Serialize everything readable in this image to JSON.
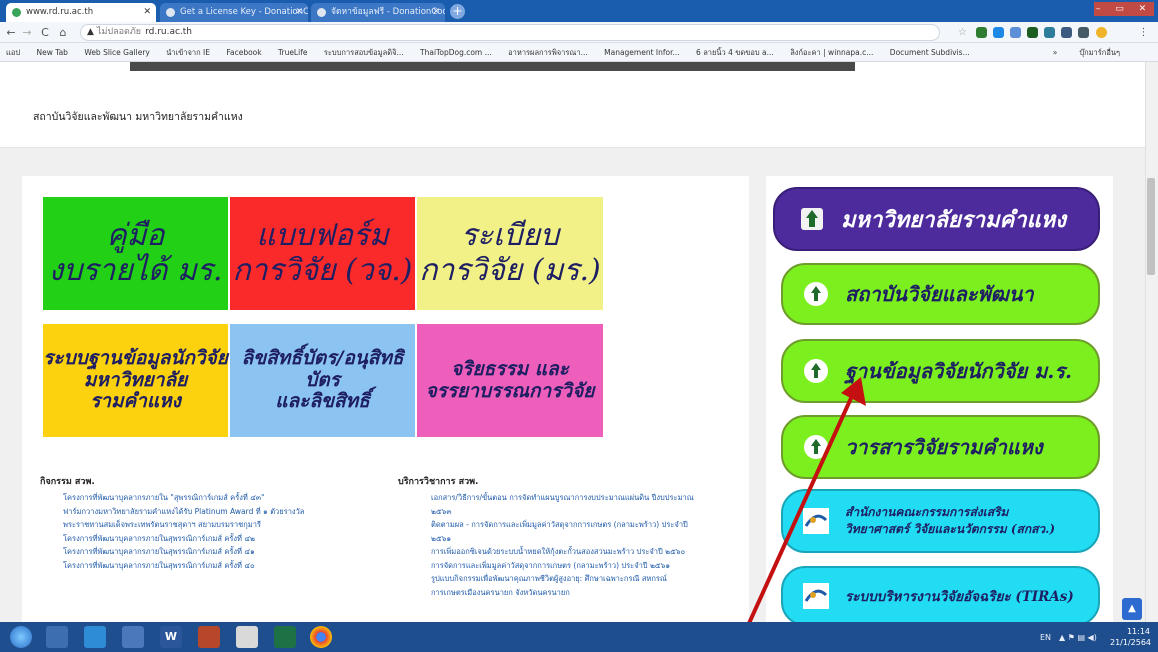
{
  "browser": {
    "tabs": [
      {
        "title": "www.rd.ru.ac.th",
        "active": true
      },
      {
        "title": "Get a License Key - DonationCoder",
        "active": false
      },
      {
        "title": "จัดหาข้อมูลฟรี - DonationCoder",
        "active": false
      }
    ],
    "new_tab_label": "+",
    "url_prefix": "ไม่ปลอดภัย",
    "url": "rd.ru.ac.th",
    "window_controls": "– ▭ ✕",
    "nav": {
      "back": "←",
      "forward": "→",
      "reload": "C",
      "home": "⌂",
      "warning": "▲"
    },
    "bookmarks": [
      "แอป",
      "New Tab",
      "Web Slice Gallery",
      "นำเข้าจาก IE",
      "Facebook",
      "TrueLife",
      "ระบบการสอบข้อมูลดิจิ...",
      "ThaiTopDog.com ...",
      "อาหารผลการพิจารณา...",
      "Management Infor...",
      "6 ลายนิ้ว 4 ขดขอบ a...",
      "ลิงก์อะคา | winnapa.c...",
      "Document Subdivis..."
    ],
    "bookmarks_other": "บุ๊กมาร์กอื่นๆ",
    "bookmarks_more": "»"
  },
  "site": {
    "title": "สถาบันวิจัยและพัฒนา มหาวิทยาลัยรามคำแหง"
  },
  "boxes": [
    {
      "line1": "คู่มือ",
      "line2": "งบรายได้ มร.",
      "color": "#22d015"
    },
    {
      "line1": "แบบฟอร์ม",
      "line2": "การวิจัย (วจ.)",
      "color": "#fb2a2a"
    },
    {
      "line1": "ระเบียบ",
      "line2": "การวิจัย (มร.)",
      "color": "#f1f188"
    },
    {
      "line1": "ระบบฐานข้อมูลนักวิจัย",
      "line2": "มหาวิทยาลัยรามคำแหง",
      "color": "#fcd10e"
    },
    {
      "line1": "ลิขสิทธิ์บัตร/อนุสิทธิบัตร",
      "line2": "และลิขสิทธิ์",
      "color": "#8cc4f1"
    },
    {
      "line1": "จริยธรรม และ",
      "line2": "จรรยาบรรณการวิจัย",
      "color": "#ed5fba"
    }
  ],
  "activities": {
    "heading": "กิจกรรม สวพ.",
    "items": [
      "โครงการที่พัฒนาบุคลากรภายใน \"สุพรรณิการ์เกมส์ ครั้งที่ ๔๓\"",
      "ฟาร์มกวางมหาวิทยาลัยรามคำแหงได้รับ Platinum Award ที่ ๑ ตัวยรางวัล",
      "พระราชทานสมเด็จพระเทพรัตนราชสุดาฯ สยามบรมราชกุมารี",
      "โครงการที่พัฒนาบุคลากรภายในสุพรรณิการ์เกมส์ ครั้งที่ ๔๒",
      "โครงการที่พัฒนาบุคลากรภายในสุพรรณิการ์เกมส์ ครั้งที่ ๔๑",
      "โครงการที่พัฒนาบุคลากรภายในสุพรรณิการ์เกมส์ ครั้งที่ ๔๐"
    ]
  },
  "services": {
    "heading": "บริการวิชาการ สวพ.",
    "items": [
      "เอกสาร/วิธีการ/ขั้นตอน การจัดทำแผนบูรณาการงบประมาณแผ่นดิน ปีงบประมาณ",
      "๒๕๖๓",
      "ติดตามผล - การจัดการและเพิ่มมูลค่าวัสดุจากการเกษตร (กลามะพร้าว) ประจำปี",
      "๒๕๖๑",
      "การเพิ่มออกซิเจนด้วยระบบน้ำหยดให้กุ้งตะกั้วนสองสวนมะพร้าว ประจำปี ๒๕๖๐",
      "การจัดการและเพิ่มมูลค่าวัสดุจากการเกษตร (กลามะพร้าว) ประจำปี ๒๕๖๑",
      "รูปแบบกิจกรรมเพื่อพัฒนาคุณภาพชีวิตผู้สูงอายุ: ศึกษาเฉพาะกรณี สหกรณ์",
      "การเกษตรเมืองนครนายก จังหวัดนครนายก"
    ]
  },
  "pills": [
    {
      "label": "มหาวิทยาลัยรามคำแหง",
      "color": "#4d2b9d"
    },
    {
      "label": "สถาบันวิจัยและพัฒนา",
      "color": "#7cf01f"
    },
    {
      "label": "ฐานข้อมูลวิจัยนักวิจัย ม.ร.",
      "color": "#7cf01f"
    },
    {
      "label": "วารสารวิจัยรามคำแหง",
      "color": "#7cf01f"
    },
    {
      "label_line1": "สำนักงานคณะกรรมการส่งเสริม",
      "label_line2": "วิทยาศาสตร์ วิจัยและนวัตกรรม (สกสว.)",
      "color": "#22dcf3"
    },
    {
      "label": "ระบบบริหารงานวิจัยอัจฉริยะ (TIRAs)",
      "color": "#22dcf3"
    }
  ],
  "scroll_up_label": "▲",
  "taskbar": {
    "tray_lang": "EN",
    "time": "11:14",
    "date": "21/1/2564"
  },
  "annotation": {
    "arrow_color": "#c41010"
  }
}
